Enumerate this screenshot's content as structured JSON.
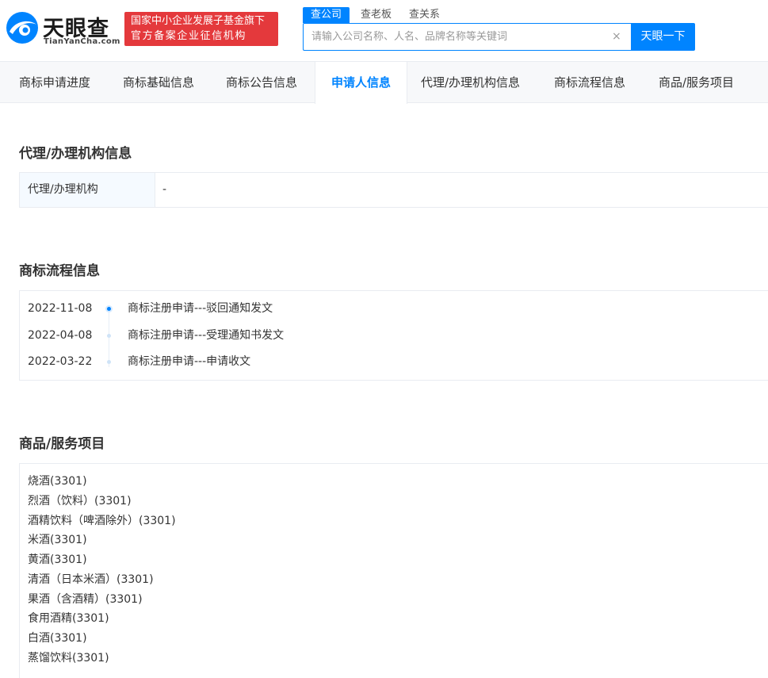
{
  "brand": {
    "name": "天眼查",
    "sub": "TianYanCha.com",
    "badge_line1": "国家中小企业发展子基金旗下",
    "badge_line2": "官方备案企业征信机构",
    "accent": "#0084ff",
    "badge_color": "#e4393c"
  },
  "search": {
    "tabs": [
      {
        "label": "查公司"
      },
      {
        "label": "查老板"
      },
      {
        "label": "查关系"
      }
    ],
    "placeholder": "请输入公司名称、人名、品牌名称等关键词",
    "clear_icon": "×",
    "button_label": "天眼一下"
  },
  "nav": {
    "tabs": [
      {
        "label": "商标申请进度"
      },
      {
        "label": "商标基础信息"
      },
      {
        "label": "商标公告信息"
      },
      {
        "label": "申请人信息"
      },
      {
        "label": "代理/办理机构信息"
      },
      {
        "label": "商标流程信息"
      },
      {
        "label": "商品/服务项目"
      }
    ],
    "active_index": 3
  },
  "agent": {
    "title": "代理/办理机构信息",
    "label": "代理/办理机构",
    "value": "-"
  },
  "flow": {
    "title": "商标流程信息",
    "items": [
      {
        "date": "2022-11-08",
        "text": "商标注册申请---驳回通知发文"
      },
      {
        "date": "2022-04-08",
        "text": "商标注册申请---受理通知书发文"
      },
      {
        "date": "2022-03-22",
        "text": "商标注册申请---申请收文"
      }
    ]
  },
  "goods": {
    "title": "商品/服务项目",
    "items": [
      "烧酒(3301)",
      "烈酒（饮料）(3301)",
      "酒精饮料（啤酒除外）(3301)",
      "米酒(3301)",
      "黄酒(3301)",
      "清酒（日本米酒）(3301)",
      "果酒（含酒精）(3301)",
      "食用酒精(3301)",
      "白酒(3301)",
      "蒸馏饮料(3301)"
    ]
  }
}
